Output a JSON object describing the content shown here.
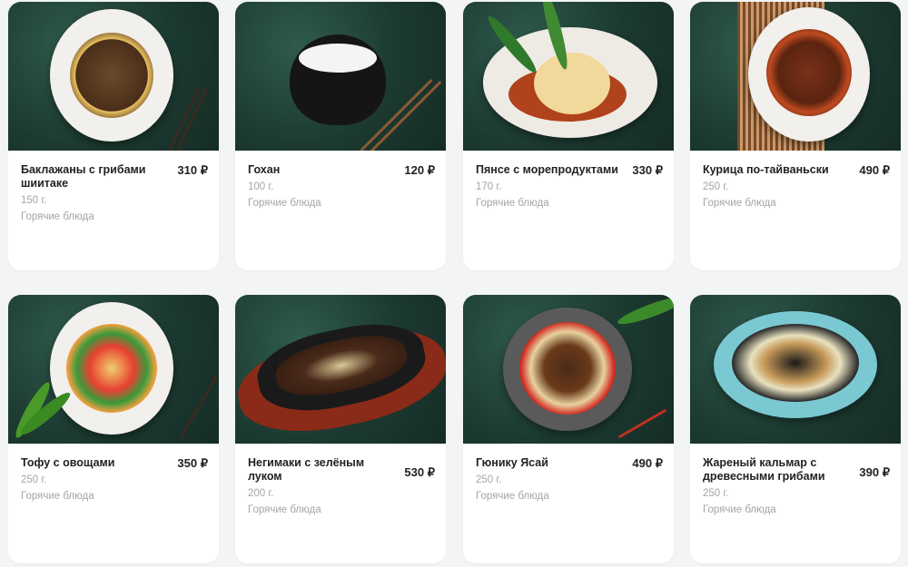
{
  "currency": "₽",
  "dishes": [
    {
      "name": "Баклажаны с грибами шиитаке",
      "price": "310",
      "weight": "150 г.",
      "category": "Горячие блюда",
      "image": "eggplant-shiitake-dish-photo"
    },
    {
      "name": "Гохан",
      "price": "120",
      "weight": "100 г.",
      "category": "Горячие блюда",
      "image": "rice-bowl-photo"
    },
    {
      "name": "Пянсе с морепродуктами",
      "price": "330",
      "weight": "170 г.",
      "category": "Горячие блюда",
      "image": "steamed-bun-seafood-photo"
    },
    {
      "name": "Курица по-тайваньски",
      "price": "490",
      "weight": "250 г.",
      "category": "Горячие блюда",
      "image": "taiwan-chicken-photo"
    },
    {
      "name": "Тофу с овощами",
      "price": "350",
      "weight": "250 г.",
      "category": "Горячие блюда",
      "image": "tofu-vegetables-photo"
    },
    {
      "name": "Негимаки с зелёным луком",
      "price": "530",
      "weight": "200 г.",
      "category": "Горячие блюда",
      "image": "negimaki-sizzling-plate-photo"
    },
    {
      "name": "Гюнику Ясай",
      "price": "490",
      "weight": "250 г.",
      "category": "Горячие блюда",
      "image": "gyuniku-yasai-photo"
    },
    {
      "name": "Жареный кальмар с древесными грибами",
      "price": "390",
      "weight": "250 г.",
      "category": "Горячие блюда",
      "image": "fried-squid-wood-mushrooms-photo"
    }
  ],
  "colors": {
    "background": "#f3f4f5",
    "card": "#ffffff",
    "photo_bg": "#1c3a31",
    "meta_text": "#a4a4a4"
  }
}
